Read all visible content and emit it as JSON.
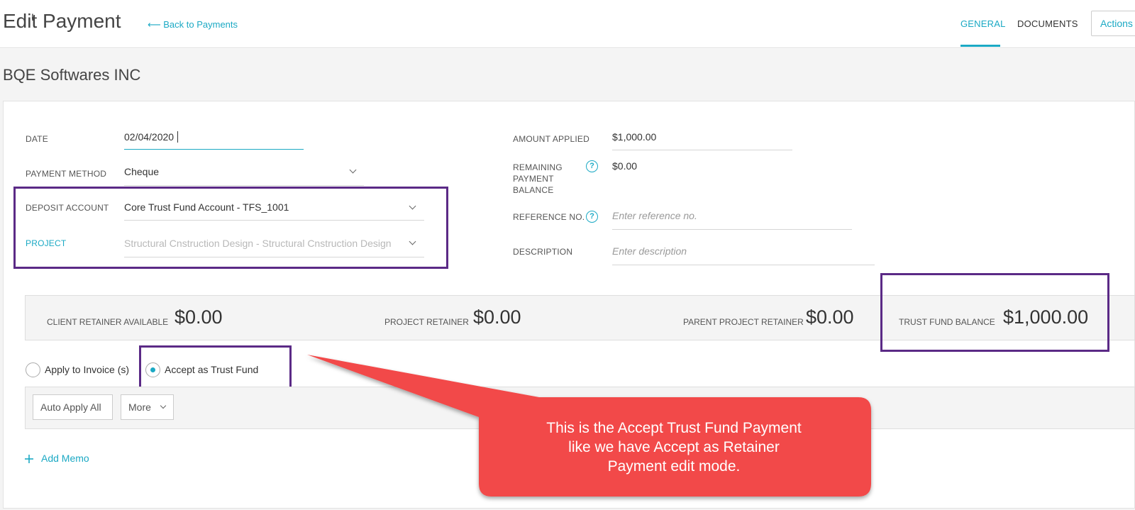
{
  "header": {
    "title": "Edit Payment",
    "back_link": "⟵ Back to Payments",
    "tabs": [
      {
        "label": "GENERAL",
        "active": true
      },
      {
        "label": "DOCUMENTS",
        "active": false
      }
    ],
    "actions_label": "Actions"
  },
  "client": {
    "name": "BQE Softwares INC"
  },
  "form": {
    "date": {
      "label": "DATE",
      "value": "02/04/2020"
    },
    "payment_method": {
      "label": "PAYMENT METHOD",
      "value": "Cheque"
    },
    "deposit_account": {
      "label": "DEPOSIT ACCOUNT",
      "value": "Core Trust Fund Account - TFS_1001"
    },
    "project": {
      "label": "PROJECT",
      "value": "Structural Cnstruction Design - Structural Cnstruction Design"
    },
    "amount_applied": {
      "label": "AMOUNT APPLIED",
      "value": "$1,000.00"
    },
    "remaining_balance": {
      "label_line1": "REMAINING",
      "label_line2": "PAYMENT",
      "label_line3": "BALANCE",
      "value": "$0.00"
    },
    "reference_no": {
      "label": "REFERENCE NO.",
      "placeholder": "Enter reference no."
    },
    "description": {
      "label": "DESCRIPTION",
      "placeholder": "Enter description"
    }
  },
  "retainers": {
    "client_retainer": {
      "label": "CLIENT RETAINER AVAILABLE",
      "value": "$0.00"
    },
    "project_retainer": {
      "label": "PROJECT RETAINER",
      "value": "$0.00"
    },
    "parent_project_retainer": {
      "label": "PARENT PROJECT RETAINER",
      "value": "$0.00"
    },
    "trust_fund_balance": {
      "label": "TRUST FUND BALANCE",
      "value": "$1,000.00"
    }
  },
  "apply_options": {
    "apply_to_invoice": {
      "label": "Apply to Invoice (s)",
      "selected": false
    },
    "accept_trust_fund": {
      "label": "Accept as Trust Fund",
      "selected": true
    }
  },
  "toolbar": {
    "auto_apply_label": "Auto Apply All",
    "more_label": "More"
  },
  "add_memo_label": "Add Memo",
  "callout": {
    "line1": "This is the Accept Trust Fund Payment",
    "line2": "like we have Accept as Retainer",
    "line3": "Payment edit mode."
  },
  "colors": {
    "accent": "#1ba9c4",
    "highlight_box": "#5b2a86",
    "callout": "#f24848"
  }
}
